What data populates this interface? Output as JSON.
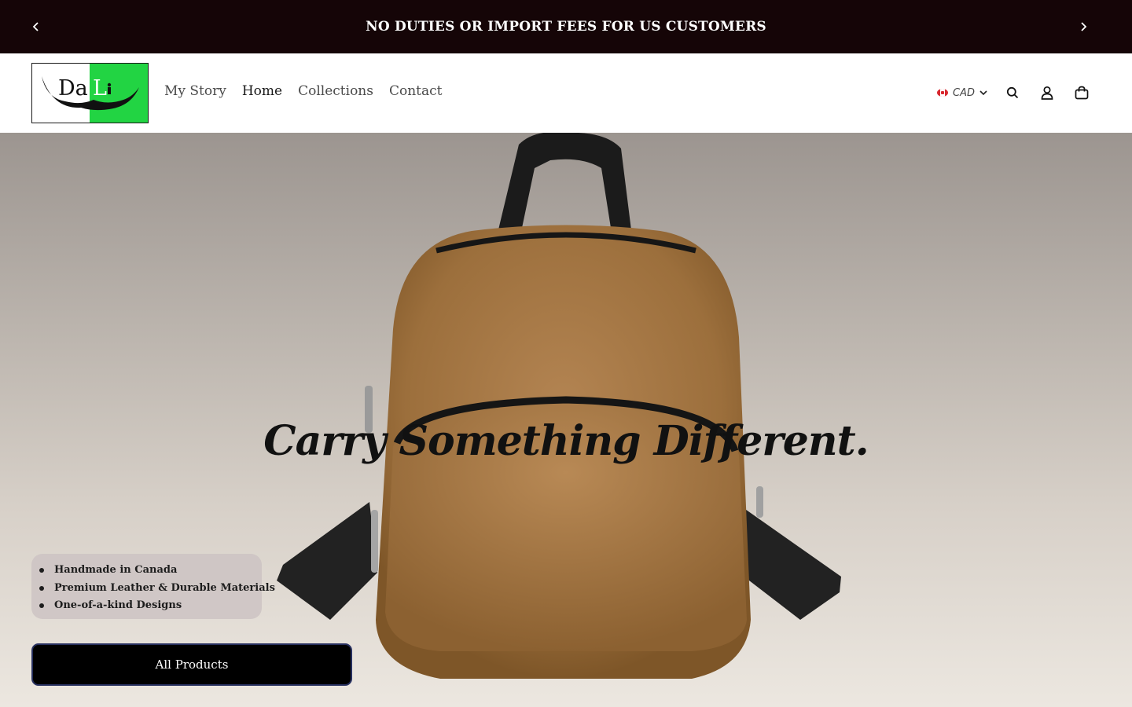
{
  "announcement": {
    "text": "NO DUTIES OR IMPORT FEES FOR US CUSTOMERS"
  },
  "header": {
    "logo_text": "DaLi",
    "nav": [
      {
        "label": "My Story"
      },
      {
        "label": "Home"
      },
      {
        "label": "Collections"
      },
      {
        "label": "Contact"
      }
    ],
    "currency": "CAD",
    "icons": [
      "search-icon",
      "account-icon",
      "cart-icon"
    ]
  },
  "hero": {
    "title": "Carry Something Different.",
    "features": [
      "Handmade in Canada",
      "Premium Leather & Durable Materials",
      "One-of-a-kind Designs"
    ],
    "cta_label": "All Products"
  },
  "colors": {
    "announcement_bg": "#150507",
    "logo_green": "#22d443",
    "cta_bg": "#000000",
    "cta_border": "#27305f",
    "bag_leather": "#a87a45"
  }
}
